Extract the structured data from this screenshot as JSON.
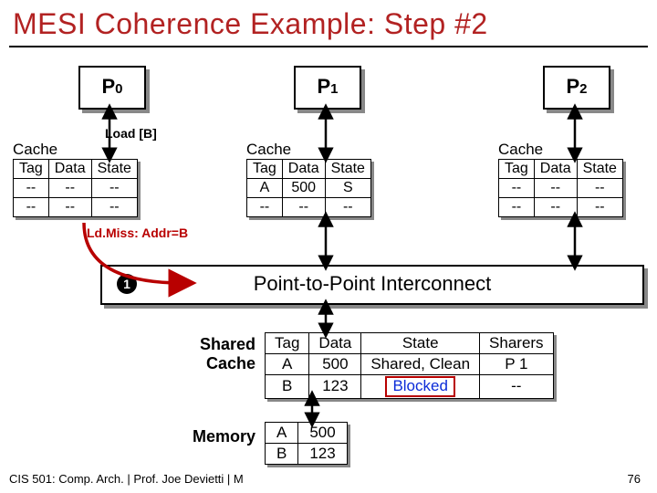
{
  "title": "MESI Coherence Example: Step #2",
  "processors": [
    {
      "name": "P",
      "sub": "0"
    },
    {
      "name": "P",
      "sub": "1"
    },
    {
      "name": "P",
      "sub": "2"
    }
  ],
  "load_label": "Load [B]",
  "miss_label": "Ld.Miss: Addr=B",
  "step_badge": "1",
  "cache_label": "Cache",
  "cache_headers": [
    "Tag",
    "Data",
    "State"
  ],
  "caches": [
    {
      "rows": [
        [
          "--",
          "--",
          "--"
        ],
        [
          "--",
          "--",
          "--"
        ]
      ]
    },
    {
      "rows": [
        [
          "A",
          "500",
          "S"
        ],
        [
          "--",
          "--",
          "--"
        ]
      ]
    },
    {
      "rows": [
        [
          "--",
          "--",
          "--"
        ],
        [
          "--",
          "--",
          "--"
        ]
      ]
    }
  ],
  "interconnect_label": "Point-to-Point Interconnect",
  "shared_cache_label_line1": "Shared",
  "shared_cache_label_line2": "Cache",
  "shared_headers": [
    "Tag",
    "Data",
    "State",
    "Sharers"
  ],
  "shared_rows": [
    {
      "tag": "A",
      "data": "500",
      "state": "Shared, Clean",
      "sharers": "P 1"
    },
    {
      "tag": "B",
      "data": "123",
      "state": "Blocked",
      "sharers": "--"
    }
  ],
  "memory_label": "Memory",
  "memory_rows": [
    [
      "A",
      "500"
    ],
    [
      "B",
      "123"
    ]
  ],
  "footer_left": "CIS 501: Comp. Arch. | Prof. Joe Devietti | M",
  "footer_right": "76"
}
